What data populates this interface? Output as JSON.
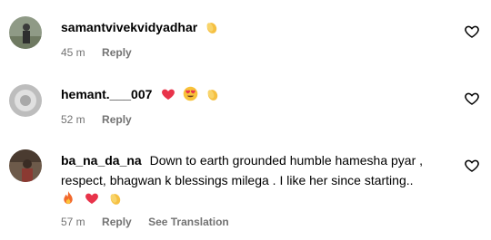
{
  "comments": [
    {
      "username": "samantvivekvidyadhar",
      "text": "",
      "emojis": [
        "clapping-hands"
      ],
      "time": "45 m",
      "reply_label": "Reply",
      "translate_label": ""
    },
    {
      "username": "hemant.___007",
      "text": "",
      "emojis": [
        "red-heart",
        "heart-eyes",
        "clapping-hands"
      ],
      "time": "52 m",
      "reply_label": "Reply",
      "translate_label": ""
    },
    {
      "username": "ba_na_da_na",
      "text_line1": "Down to earth grounded humble hamesha pyar ,",
      "text_line2": "respect, bhagwan k blessings milega . I like her since starting..",
      "emojis": [
        "fire",
        "red-heart",
        "clapping-hands"
      ],
      "time": "57 m",
      "reply_label": "Reply",
      "translate_label": "See Translation"
    }
  ],
  "icons": {
    "like": "heart-outline-icon"
  },
  "colors": {
    "secondary_text": "#737373",
    "heart_red": "#e8334a"
  }
}
